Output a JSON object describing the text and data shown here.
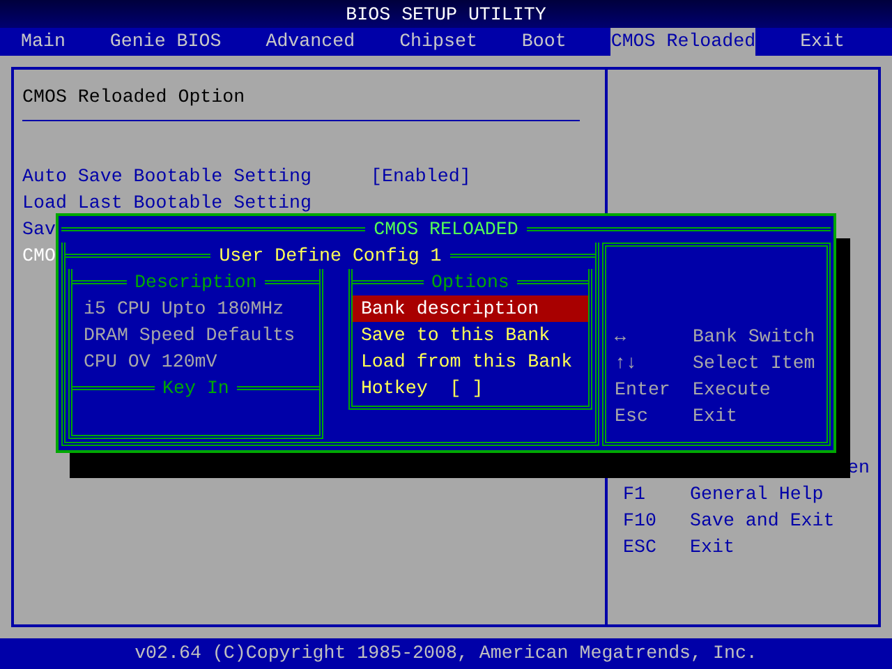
{
  "title": "BIOS SETUP UTILITY",
  "tabs": [
    {
      "label": "Main",
      "selected": false
    },
    {
      "label": "Genie BIOS",
      "selected": false
    },
    {
      "label": "Advanced",
      "selected": false
    },
    {
      "label": "Chipset",
      "selected": false
    },
    {
      "label": "Boot",
      "selected": false
    },
    {
      "label": "CMOS Reloaded",
      "selected": true
    },
    {
      "label": "Exit",
      "selected": false
    }
  ],
  "panel": {
    "heading": "CMOS Reloaded Option",
    "items": [
      {
        "label": "Auto Save Bootable Setting",
        "value": "[Enabled]",
        "selected": false
      },
      {
        "label": "Load Last Bootable Setting",
        "selected": false
      },
      {
        "label": "Sav",
        "selected": false
      },
      {
        "label": "CMO",
        "selected": true
      }
    ]
  },
  "help": {
    "partial": "en",
    "keys": [
      {
        "key": "F1",
        "action": "General Help"
      },
      {
        "key": "F10",
        "action": "Save and Exit"
      },
      {
        "key": "ESC",
        "action": "Exit"
      }
    ]
  },
  "dialog": {
    "title": "CMOS RELOADED",
    "subtitle": "User Define Config 1",
    "description": {
      "heading": "Description",
      "lines": [
        "i5 CPU Upto 180MHz",
        "DRAM Speed Defaults",
        "CPU OV 120mV"
      ]
    },
    "key_in": {
      "heading": "Key In"
    },
    "options": {
      "heading": "Options",
      "items": [
        {
          "label": "Bank description",
          "selected": true
        },
        {
          "label": "Save to this Bank",
          "selected": false
        },
        {
          "label": "Load from this Bank",
          "selected": false
        },
        {
          "label": "Hotkey  [ ]",
          "selected": false
        }
      ]
    },
    "keys": [
      {
        "key": "↔",
        "action": "Bank Switch"
      },
      {
        "key": "↑↓",
        "action": "Select Item"
      },
      {
        "key": "Enter",
        "action": "Execute"
      },
      {
        "key": "Esc",
        "action": "Exit"
      }
    ]
  },
  "footer": "v02.64 (C)Copyright 1985-2008, American Megatrends, Inc."
}
